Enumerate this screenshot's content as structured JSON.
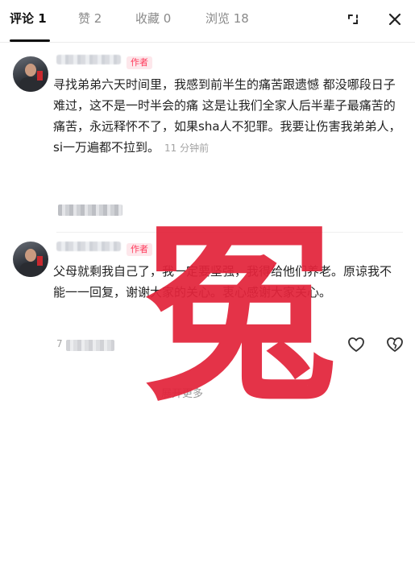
{
  "tabs": [
    {
      "label": "评论 1"
    },
    {
      "label": "赞 2"
    },
    {
      "label": "收藏 0"
    },
    {
      "label": "浏览 18"
    }
  ],
  "comments": [
    {
      "badge": "作者",
      "text": "寻找弟弟六天时间里，我感到前半生的痛苦跟遗憾 都没哪段日子难过，这不是一时半会的痛 这是让我们全家人后半辈子最痛苦的痛苦，永远释怀不了，如果sha人不犯罪。我要让伤害我弟弟人，si一万遍都不拉到。",
      "time": "11 分钟前"
    },
    {
      "badge": "作者",
      "text": "父母就剩我自己了，我一定要坚强，我得给他们养老。原谅我不能一一回复，谢谢大家的关心。衷心感谢大家关心。",
      "time": "7"
    }
  ],
  "more_link": "展开更多",
  "stamp": "冤",
  "colors": {
    "accent": "#ff3b5c",
    "stamp": "#e3243b",
    "badge_bg": "#fde7eb"
  },
  "icons": [
    "expand-icon",
    "close-icon",
    "heart-icon",
    "dislike-heart-icon"
  ]
}
